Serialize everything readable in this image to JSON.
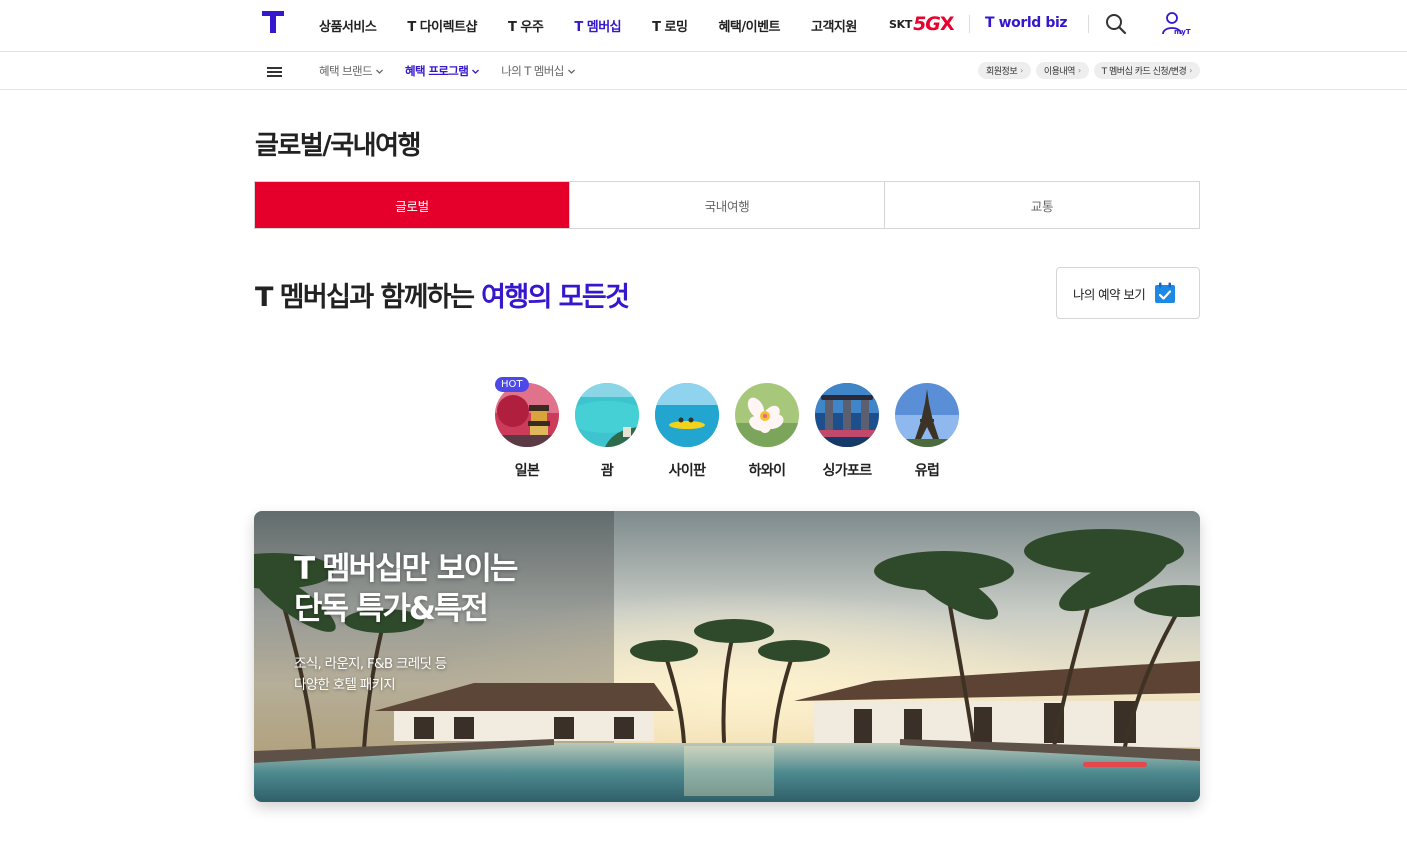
{
  "header": {
    "nav_items": [
      "상품서비스",
      "T 다이렉트샵",
      "T 우주",
      "T 멤버십",
      "T 로밍",
      "혜택/이벤트",
      "고객지원"
    ],
    "active_nav": "T 멤버십",
    "skt_label": "SKT",
    "five_label": "5G",
    "gx_label": "X",
    "tworld_label": "T world biz",
    "myt_label": "myT"
  },
  "subnav": {
    "items": [
      "혜택 브랜드",
      "혜택 프로그램",
      "나의 T 멤버십"
    ],
    "active_item": "혜택 프로그램",
    "quick_links": [
      "회원정보",
      "이용내역",
      "T 멤버십 카드 신청/변경"
    ]
  },
  "page": {
    "title": "글로벌/국내여행",
    "tabs": [
      "글로벌",
      "국내여행",
      "교통"
    ],
    "active_tab": "글로벌"
  },
  "headline": {
    "text_plain": "T 멤버십과 함께하는 ",
    "text_accent": "여행의 모든것"
  },
  "reservation": {
    "label": "나의 예약 보기"
  },
  "destinations": [
    {
      "label": "일본",
      "badge": "HOT"
    },
    {
      "label": "괌"
    },
    {
      "label": "사이판"
    },
    {
      "label": "하와이"
    },
    {
      "label": "싱가포르"
    },
    {
      "label": "유럽"
    }
  ],
  "banner": {
    "title_line1": "T 멤버십만 보이는",
    "title_line2": "단독 특가&특전",
    "subtitle_line1": "조식, 라운지, F&B 크레딧 등",
    "subtitle_line2": "다양한 호텔 패키지"
  },
  "colors": {
    "brand_purple": "#3617ce",
    "active_tab_red": "#e4002b",
    "hot_badge": "#4c49e8",
    "banner_progress": "#e4484a"
  },
  "icons": [
    "t-logo-icon",
    "search-icon",
    "myt-user-icon",
    "menu-icon",
    "chevron-down-icon",
    "calendar-check-icon"
  ]
}
